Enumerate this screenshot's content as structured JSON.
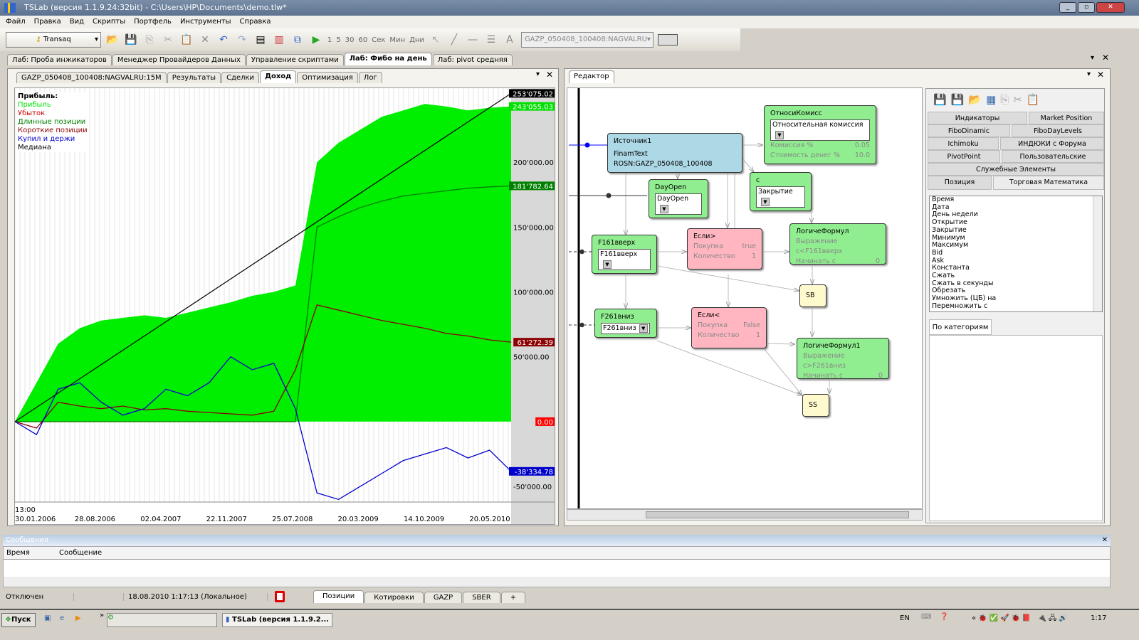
{
  "window": {
    "title": "TSLab (версия 1.1.9.24:32bit) - C:\\Users\\HP\\Documents\\demo.tlw*"
  },
  "menu": [
    "Файл",
    "Правка",
    "Вид",
    "Скрипты",
    "Портфель",
    "Инструменты",
    "Справка"
  ],
  "toolbar": {
    "provider": "Transaq",
    "intervals": [
      "1",
      "5",
      "30",
      "60"
    ],
    "units": [
      "Сек",
      "Мин",
      "Дни"
    ],
    "symbol": "GAZP_050408_100408:NAGVALRU"
  },
  "doc_tabs": [
    {
      "label": "Лаб: Проба инжикаторов"
    },
    {
      "label": "Менеджер Провайдеров Данных"
    },
    {
      "label": "Управление скриптами"
    },
    {
      "label": "Лаб: Фибо на день",
      "active": true
    },
    {
      "label": "Лаб: pivot средняя"
    }
  ],
  "left_tabs": [
    {
      "label": "GAZP_050408_100408:NAGVALRU:15M"
    },
    {
      "label": "Результаты"
    },
    {
      "label": "Сделки"
    },
    {
      "label": "Доход",
      "active": true
    },
    {
      "label": "Оптимизация"
    },
    {
      "label": "Лог"
    }
  ],
  "legend": {
    "title": "Прибыль:",
    "items": [
      {
        "label": "Прибыль",
        "color": "#00e000"
      },
      {
        "label": "Убыток",
        "color": "#d00000"
      },
      {
        "label": "Длинные позиции",
        "color": "#008000"
      },
      {
        "label": "Короткие позиции",
        "color": "#8b0000"
      },
      {
        "label": "Купил и держи",
        "color": "#0000cc"
      },
      {
        "label": "Медиана",
        "color": "#000000"
      }
    ]
  },
  "chart_data": {
    "type": "area",
    "ylim": [
      -62000,
      256000
    ],
    "y_ticks": [
      "200'000.00",
      "150'000.00",
      "100'000.00",
      "50'000.00",
      "-50'000.00"
    ],
    "y_tick_values": [
      200000,
      150000,
      100000,
      50000,
      -50000
    ],
    "x_ticks": [
      "30.01.2006",
      "28.08.2006",
      "02.04.2007",
      "22.11.2007",
      "25.07.2008",
      "20.03.2009",
      "14.10.2009",
      "20.05.2010"
    ],
    "time_label": "13:00",
    "last_values": [
      {
        "text": "253'075.02",
        "value": 253075.02,
        "bg": "#000000",
        "fg": "#ffffff"
      },
      {
        "text": "243'055.03",
        "value": 243055.03,
        "bg": "#00e000",
        "fg": "#ffffff"
      },
      {
        "text": "181'782.64",
        "value": 181782.64,
        "bg": "#008000",
        "fg": "#ffffff"
      },
      {
        "text": "61'272.39",
        "value": 61272.39,
        "bg": "#8b0000",
        "fg": "#ffffff"
      },
      {
        "text": "0.00",
        "value": 0,
        "bg": "#ff0000",
        "fg": "#ffffff"
      },
      {
        "text": "-38'334.78",
        "value": -38334.78,
        "bg": "#0000cc",
        "fg": "#ffffff"
      }
    ],
    "series": [
      {
        "name": "Прибыль",
        "color": "#00ee00",
        "fill": true,
        "values": [
          0,
          30000,
          60000,
          72000,
          78000,
          80000,
          82000,
          80000,
          84000,
          88000,
          92000,
          97000,
          100000,
          105000,
          200000,
          215000,
          225000,
          235000,
          240000,
          245000,
          243000,
          240000,
          242000,
          243055
        ]
      },
      {
        "name": "Длинные позиции",
        "color": "#008000",
        "values": [
          0,
          0,
          0,
          0,
          0,
          0,
          0,
          0,
          0,
          0,
          0,
          0,
          0,
          0,
          150000,
          158000,
          165000,
          170000,
          174000,
          176000,
          178000,
          180000,
          181000,
          181782
        ]
      },
      {
        "name": "Короткие позиции",
        "color": "#8b0000",
        "values": [
          0,
          -5000,
          15000,
          12000,
          10000,
          12000,
          9000,
          10000,
          8000,
          7000,
          6000,
          5000,
          8000,
          40000,
          90000,
          86000,
          82000,
          78000,
          75000,
          72000,
          68000,
          66000,
          63000,
          61272
        ]
      },
      {
        "name": "Купил и держи",
        "color": "#0000cc",
        "values": [
          0,
          -10000,
          25000,
          30000,
          15000,
          5000,
          10000,
          25000,
          20000,
          30000,
          50000,
          40000,
          45000,
          10000,
          -55000,
          -60000,
          -50000,
          -40000,
          -30000,
          -25000,
          -20000,
          -28000,
          -22000,
          -38334
        ]
      },
      {
        "name": "Медиана",
        "color": "#000000",
        "values": [
          0,
          253075
        ]
      }
    ]
  },
  "editor": {
    "tab": "Редактор",
    "nodes": {
      "src": {
        "title": "Источник1",
        "text": "FinamText ROSN:GAZP_050408_100408"
      },
      "comm": {
        "title": "ОтносиКомисс",
        "select": "Относительная комиссия",
        "p1": "Комиссия %",
        "v1": "0.05",
        "p2": "Стоимость денег %",
        "v2": "10.0"
      },
      "dayopen": {
        "title": "DayOpen",
        "select": "DayOpen"
      },
      "c": {
        "title": "с",
        "select": "Закрытие"
      },
      "f161": {
        "title": "F161вверх",
        "select": "F161вверх"
      },
      "if1": {
        "title": "Если>",
        "p1": "Покупка",
        "v1": "true",
        "p2": "Количество",
        "v2": "1"
      },
      "lf": {
        "title": "ЛогичеФормул",
        "p1": "Выражение с<F161вверх",
        "p2": "Начинать с",
        "v2": "0"
      },
      "sb": {
        "title": "SB"
      },
      "f261": {
        "title": "F261вниз",
        "select": "F261вниз"
      },
      "if2": {
        "title": "Если<",
        "p1": "Покупка",
        "v1": "False",
        "p2": "Количество",
        "v2": "1"
      },
      "lf1": {
        "title": "ЛогичеФормул1",
        "p1": "Выражение с>F261вниз",
        "p2": "Начинать с",
        "v2": "0"
      },
      "ss": {
        "title": "SS"
      }
    }
  },
  "palette": {
    "categories": [
      "Индикаторы",
      "Market Position",
      "FiboDinamic",
      "FiboDayLevels",
      "Ichimoku",
      "ИНДЮКИ с Форума",
      "PivotPoint",
      "Пользовательские",
      "Служебные Элементы",
      "Позиция",
      "Торговая Математика"
    ],
    "items": [
      "Время",
      "Дата",
      "День недели",
      "Открытие",
      "Закрытие",
      "Минимум",
      "Максимум",
      "Bid",
      "Ask",
      "Константа",
      "Сжать",
      "Сжать в секунды",
      "Обрезать",
      "Умножить (ЦБ) на",
      "Перемножить с"
    ],
    "bottom_tab": "По категориям"
  },
  "messages": {
    "title": "Сообщения",
    "col_time": "Время",
    "col_msg": "Сообщение"
  },
  "status": {
    "connection": "Отключен",
    "datetime": "18.08.2010 1:17:13 (Локальное)",
    "tabs": [
      "Позиции",
      "Котировки",
      "GAZP",
      "SBER",
      "+"
    ]
  },
  "taskbar": {
    "start": "Пуск",
    "task": "TSLab (версия 1.1.9.2...",
    "lang": "EN",
    "clock": "1:17"
  }
}
